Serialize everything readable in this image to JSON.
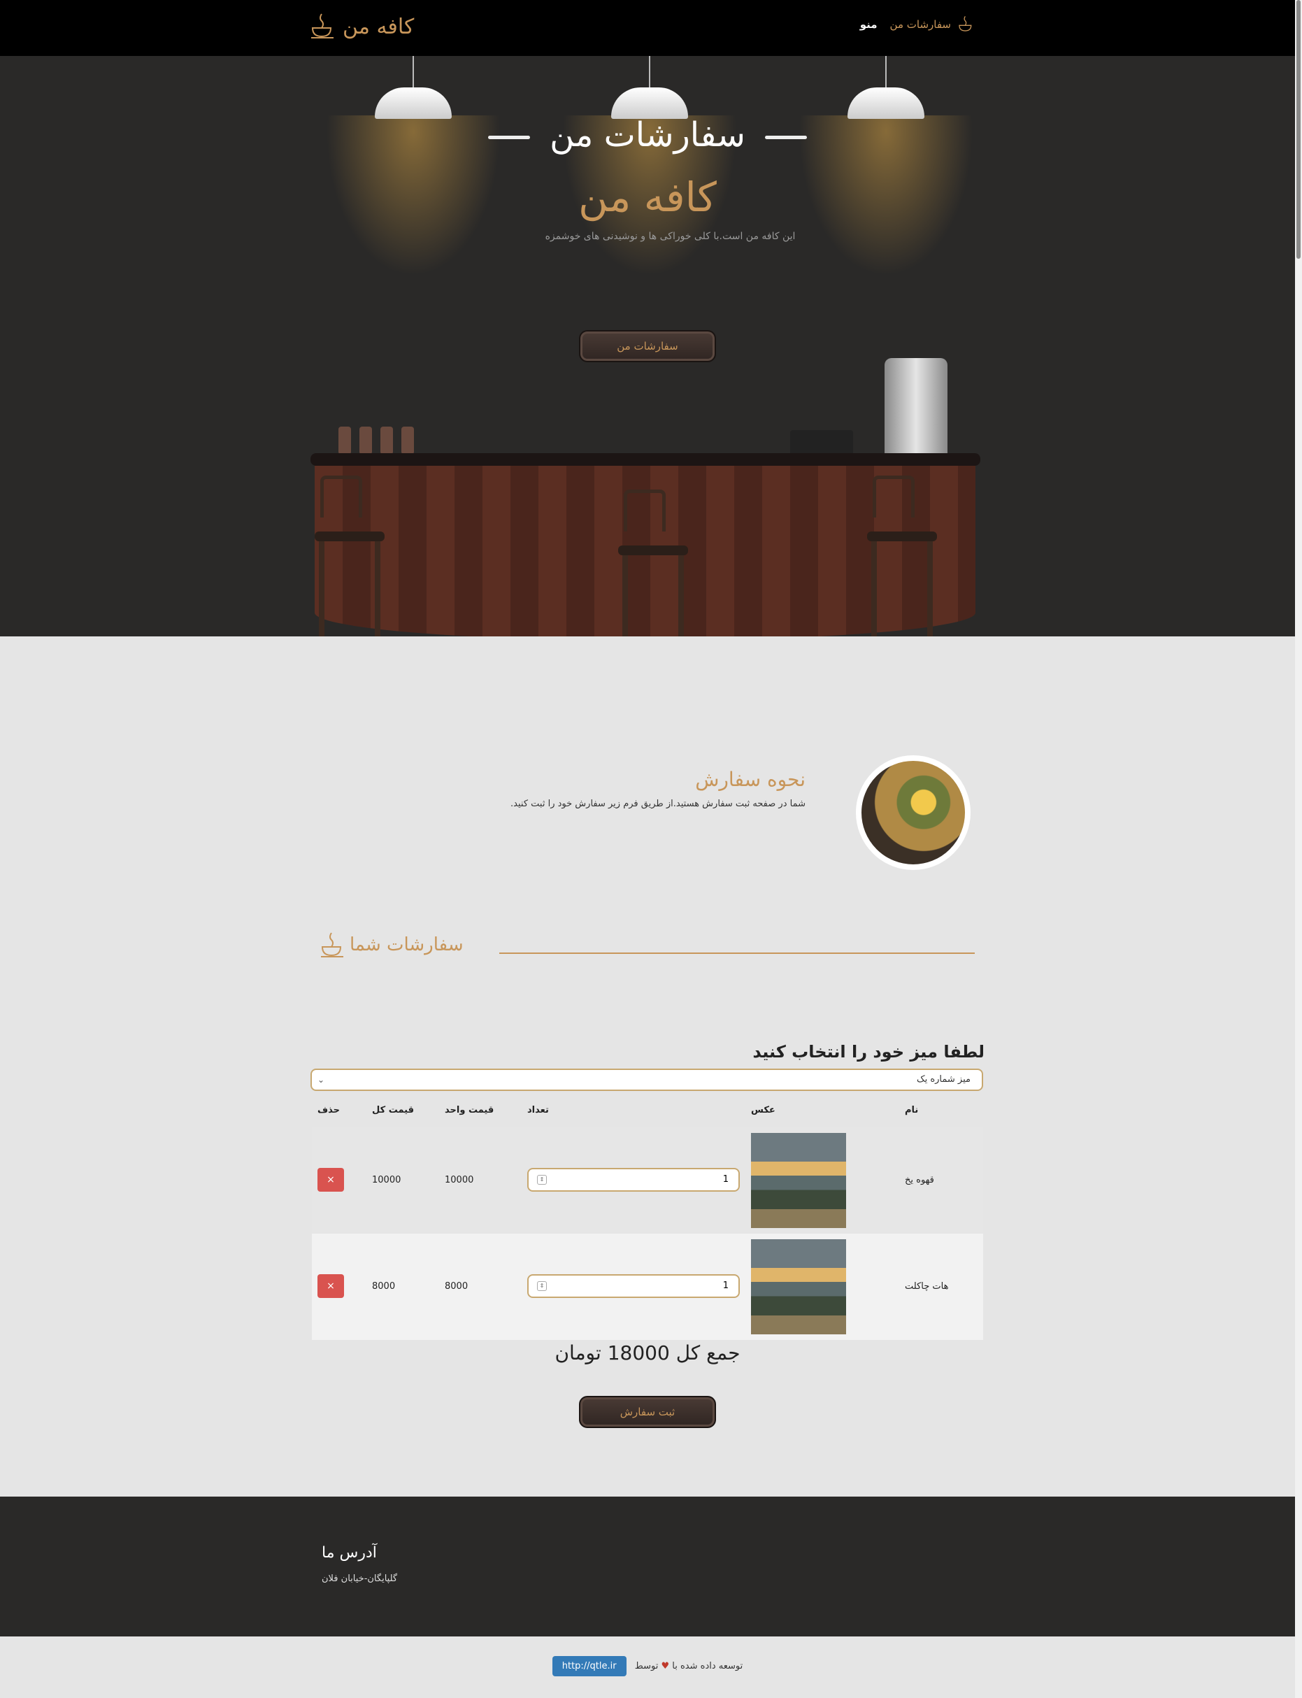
{
  "nav": {
    "brand": "کافه من",
    "menu": [
      {
        "label": "سفارشات من",
        "icon": "coffee-cup-icon"
      },
      {
        "label": "منو"
      }
    ]
  },
  "hero": {
    "title": "سفارشات من",
    "subtitle": "کافه من",
    "description": "این کافه من است.با کلی خوراکی ها و نوشیدنی های خوشمزه",
    "button": "سفارشات من"
  },
  "how_to_order": {
    "title": "نحوه سفارش",
    "text": "شما در صفحه ثبت سفارش هستید.از طریق فرم زیر سفارش خود را ثبت کنید."
  },
  "orders": {
    "heading": "سفارشات شما",
    "choose_table_label": "لطفا میز خود را انتخاب کنید",
    "selected_table": "میز شماره یک",
    "columns": [
      "نام",
      "عکس",
      "تعداد",
      "قیمت واحد",
      "قیمت کل",
      "حذف"
    ],
    "rows": [
      {
        "name": "قهوه یخ",
        "qty": "1",
        "unit_price": "10000",
        "total_price": "10000"
      },
      {
        "name": "هات چاکلت",
        "qty": "1",
        "unit_price": "8000",
        "total_price": "8000"
      }
    ],
    "delete_symbol": "×",
    "grand_total": "جمع کل 18000 تومان",
    "submit": "ثبت سفارش"
  },
  "footer": {
    "title": "آدرس ما",
    "address": "گلپایگان-خیابان فلان"
  },
  "credit": {
    "text_before": "توسعه داده شده با",
    "text_after": "توسط",
    "link": "http://qtle.ir"
  },
  "colors": {
    "accent": "#c8965a",
    "dark": "#2a2928",
    "danger": "#d9534f",
    "link": "#337ab7"
  }
}
